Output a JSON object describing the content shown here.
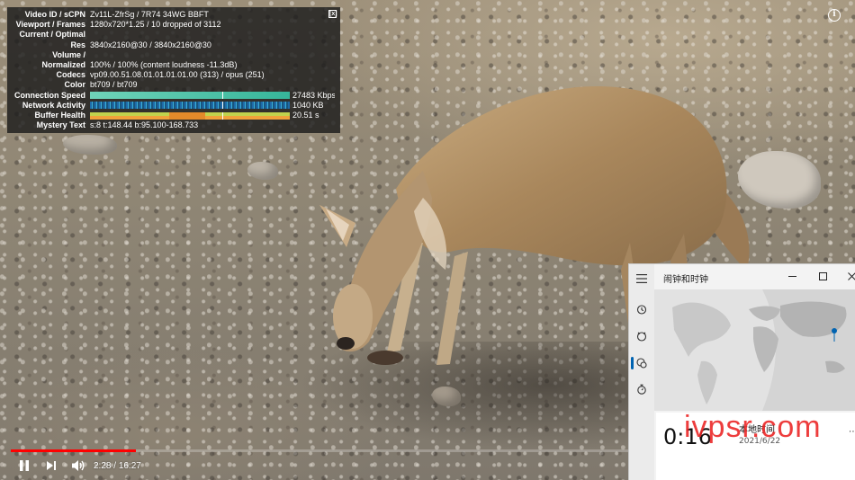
{
  "stats": {
    "rows": [
      {
        "label": "Video ID / sCPN",
        "value": "Zv11L-ZfrSg / 7R74 34WG BBFT"
      },
      {
        "label": "Viewport / Frames",
        "value": "1280x720*1.25 / 10 dropped of 3112"
      },
      {
        "label": "Current / Optimal",
        "value": ""
      },
      {
        "label": "Res",
        "value": "3840x2160@30 / 3840x2160@30"
      },
      {
        "label": "Volume /",
        "value": ""
      },
      {
        "label": "Normalized",
        "value": "100% / 100% (content loudness -11.3dB)"
      },
      {
        "label": "Codecs",
        "value": "vp09.00.51.08.01.01.01.01.00 (313) / opus (251)"
      },
      {
        "label": "Color",
        "value": "bt709 / bt709"
      }
    ],
    "connection_speed_label": "Connection Speed",
    "connection_speed_value": "27483 Kbps",
    "network_activity_label": "Network Activity",
    "network_activity_value": "1040 KB",
    "buffer_health_label": "Buffer Health",
    "buffer_health_value": "20.51 s",
    "mystery_label": "Mystery Text",
    "mystery_value": "s:8 t:148.44 b:95.100-168.733",
    "close_label": "[x]"
  },
  "player": {
    "current_time": "2:28",
    "separator": " / ",
    "duration": "16:27",
    "progress_fraction": 0.15,
    "info_label": "i",
    "accent": "#ff0000"
  },
  "clock_app": {
    "title": "闹钟和时钟",
    "nav_icons": [
      "alarm-icon",
      "timer-icon",
      "world-clock-icon",
      "stopwatch-icon"
    ],
    "local_time": "0:16",
    "local_label": "本地时间",
    "local_date": "2021/6/22",
    "more": "⋯",
    "accent": "#0063b1"
  },
  "watermark": "ivpsr.com"
}
